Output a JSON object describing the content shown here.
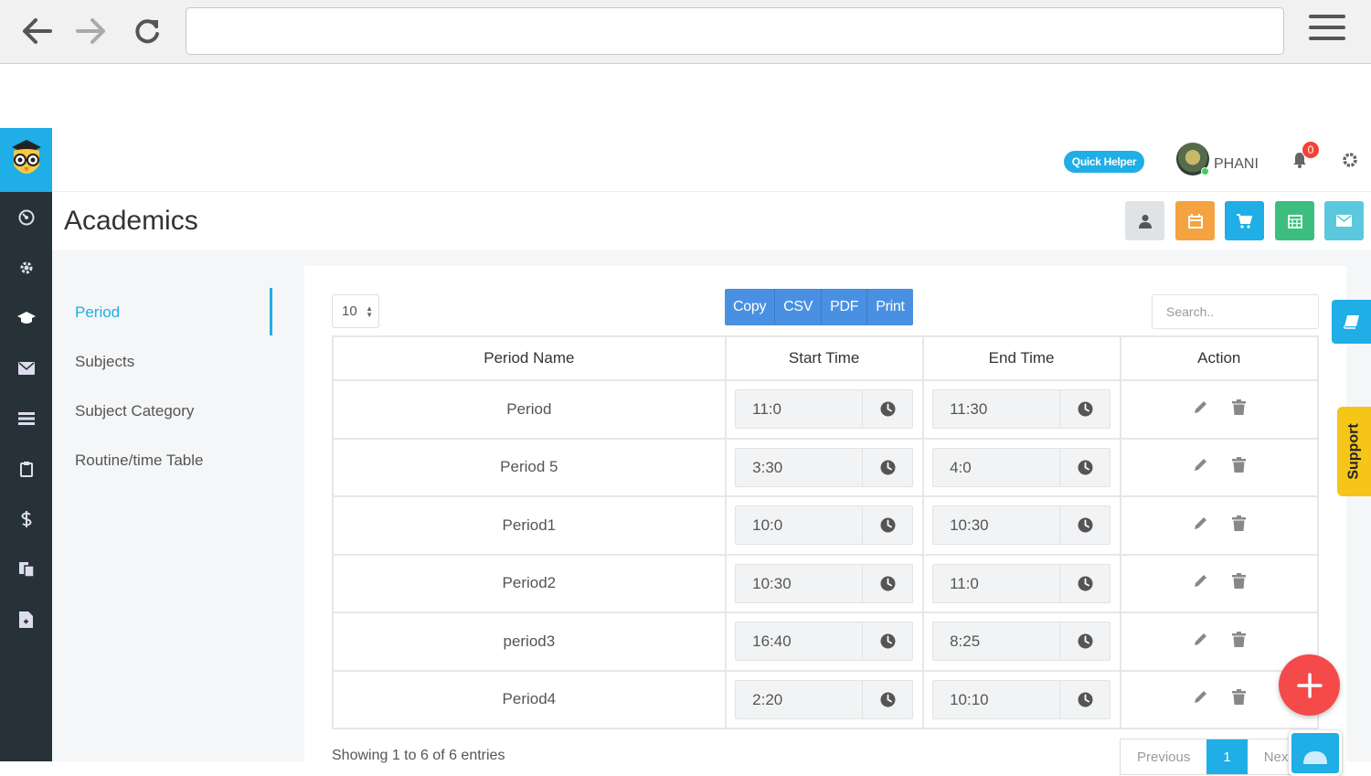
{
  "browser": {
    "address_value": ""
  },
  "header": {
    "quick_helper_label": "Quick Helper",
    "username": "PHANI",
    "notification_count": "0"
  },
  "page": {
    "title": "Academics"
  },
  "subnav": {
    "items": [
      "Period",
      "Subjects",
      "Subject Category",
      "Routine/time Table"
    ],
    "active": "Period"
  },
  "table_controls": {
    "page_length": "10",
    "export_buttons": [
      "Copy",
      "CSV",
      "PDF",
      "Print"
    ],
    "search_placeholder": "Search.."
  },
  "table": {
    "columns": [
      "Period Name",
      "Start Time",
      "End Time",
      "Action"
    ],
    "rows": [
      {
        "name": "Period",
        "start": "11:0",
        "end": "11:30"
      },
      {
        "name": "Period 5",
        "start": "3:30",
        "end": "4:0"
      },
      {
        "name": "Period1",
        "start": "10:0",
        "end": "10:30"
      },
      {
        "name": "Period2",
        "start": "10:30",
        "end": "11:0"
      },
      {
        "name": "period3",
        "start": "16:40",
        "end": "8:25"
      },
      {
        "name": "Period4",
        "start": "2:20",
        "end": "10:10"
      }
    ]
  },
  "footer": {
    "showing_text": "Showing 1 to 6 of 6 entries",
    "pagination": [
      "Previous",
      "1",
      "Next"
    ]
  },
  "widgets": {
    "support_label": "Support"
  },
  "colors": {
    "brand": "#1faee5",
    "sidebar": "#263238",
    "export": "#4a90e2",
    "fab": "#f44a4a",
    "support": "#f5c518"
  }
}
